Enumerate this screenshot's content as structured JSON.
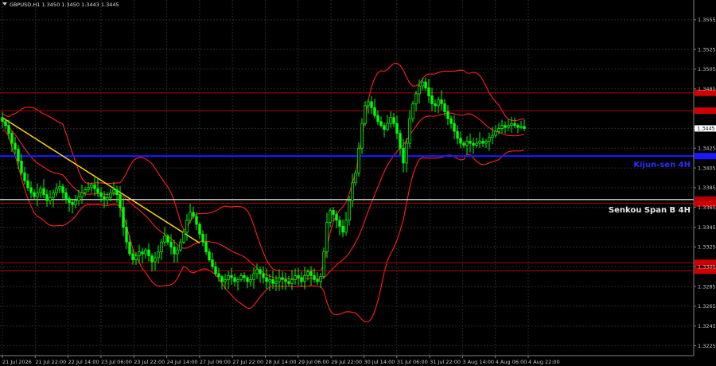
{
  "header": {
    "symbol_info": "GBPUSD,H1  1.3450 1.3450 1.3443 1.3445"
  },
  "chart_data": {
    "type": "candlestick",
    "symbol": "GBPUSD",
    "timeframe": "H1",
    "title": "GBPUSD,H1  1.3450 1.3450 1.3443 1.3445",
    "ylim": [
      1.3215,
      1.3575
    ],
    "y_ticks": [
      "1.3555",
      "1.3525",
      "1.3505",
      "1.3485",
      "1.3445",
      "1.3425",
      "1.3405",
      "1.3385",
      "1.3365",
      "1.3345",
      "1.3325",
      "1.3305",
      "1.3285",
      "1.3265",
      "1.3245",
      "1.3225"
    ],
    "x_ticks": [
      "21 Jul 2026",
      "21 Jul 22:00",
      "22 Jul 14:00",
      "23 Jul 06:00",
      "23 Jul 22:00",
      "24 Jul 14:00",
      "27 Jul 06:00",
      "27 Jul 22:00",
      "28 Jul 14:00",
      "29 Jul 06:00",
      "29 Jul 22:00",
      "30 Jul 14:00",
      "31 Jul 06:00",
      "31 Jul 22:00",
      "3 Aug 14:00",
      "4 Aug 06:00",
      "4 Aug 22:00"
    ],
    "current_price": "1.3445",
    "colors": {
      "background": "#000000",
      "grid": "#2a2a2a",
      "candle": "#00ff00",
      "bollinger": "#ff2020",
      "level": "#b00000",
      "kijun": "#1a1aff",
      "senkou": "#ffffff",
      "trend": "#ffd700",
      "text": "#c8c8c8"
    },
    "horizontal_levels": [
      {
        "name": "",
        "price": 1.3481,
        "type": "resistance"
      },
      {
        "name": "",
        "price": 1.3463,
        "type": "resistance"
      },
      {
        "name": "Kijun-sen 4H",
        "price": 1.3417,
        "type": "kijun"
      },
      {
        "name": "Senkou Span B 4H",
        "price": 1.3373,
        "type": "senkou"
      },
      {
        "name": "",
        "price": 1.3369,
        "type": "resistance"
      },
      {
        "name": "",
        "price": 1.3309,
        "type": "support"
      },
      {
        "name": "",
        "price": 1.3301,
        "type": "support"
      }
    ],
    "trend_line": {
      "from": {
        "bar": 0,
        "price": 1.3456
      },
      "to": {
        "bar": 62,
        "price": 1.3329
      }
    },
    "candles_close": [
      1.3452,
      1.3448,
      1.344,
      1.343,
      1.3424,
      1.3412,
      1.34,
      1.3392,
      1.3385,
      1.338,
      1.3376,
      1.338,
      1.3384,
      1.3378,
      1.3372,
      1.3375,
      1.338,
      1.3384,
      1.3386,
      1.338,
      1.3374,
      1.337,
      1.3368,
      1.3372,
      1.3376,
      1.338,
      1.3383,
      1.3385,
      1.3388,
      1.3384,
      1.338,
      1.3376,
      1.3373,
      1.3375,
      1.338,
      1.3383,
      1.3378,
      1.3365,
      1.3345,
      1.333,
      1.3318,
      1.3312,
      1.3316,
      1.332,
      1.3318,
      1.3322,
      1.3316,
      1.331,
      1.3314,
      1.332,
      1.333,
      1.3336,
      1.333,
      1.3325,
      1.3318,
      1.3322,
      1.333,
      1.334,
      1.3352,
      1.336,
      1.3356,
      1.3348,
      1.3338,
      1.333,
      1.332,
      1.3312,
      1.3305,
      1.3298,
      1.3295,
      1.329,
      1.3292,
      1.3296,
      1.3294,
      1.329,
      1.3292,
      1.3296,
      1.3294,
      1.329,
      1.3292,
      1.3298,
      1.3302,
      1.3298,
      1.3294,
      1.329,
      1.3292,
      1.3288,
      1.329,
      1.3294,
      1.3292,
      1.329,
      1.3288,
      1.3292,
      1.3296,
      1.3294,
      1.329,
      1.3296,
      1.33,
      1.3296,
      1.3292,
      1.329,
      1.3295,
      1.332,
      1.335,
      1.3362,
      1.3358,
      1.3352,
      1.3346,
      1.334,
      1.3352,
      1.3372,
      1.339,
      1.34,
      1.3425,
      1.345,
      1.3468,
      1.3472,
      1.3466,
      1.3458,
      1.3452,
      1.3448,
      1.3444,
      1.345,
      1.3456,
      1.345,
      1.344,
      1.3425,
      1.341,
      1.343,
      1.3455,
      1.347,
      1.348,
      1.3488,
      1.3492,
      1.3486,
      1.3478,
      1.347,
      1.3468,
      1.3474,
      1.347,
      1.3462,
      1.3455,
      1.345,
      1.3442,
      1.3435,
      1.343,
      1.3428,
      1.3432,
      1.343,
      1.3428,
      1.343,
      1.3432,
      1.343,
      1.3432,
      1.3436,
      1.3438,
      1.3442,
      1.3445,
      1.3448,
      1.3446,
      1.3448,
      1.345,
      1.3448,
      1.3446,
      1.3447,
      1.3445
    ]
  }
}
